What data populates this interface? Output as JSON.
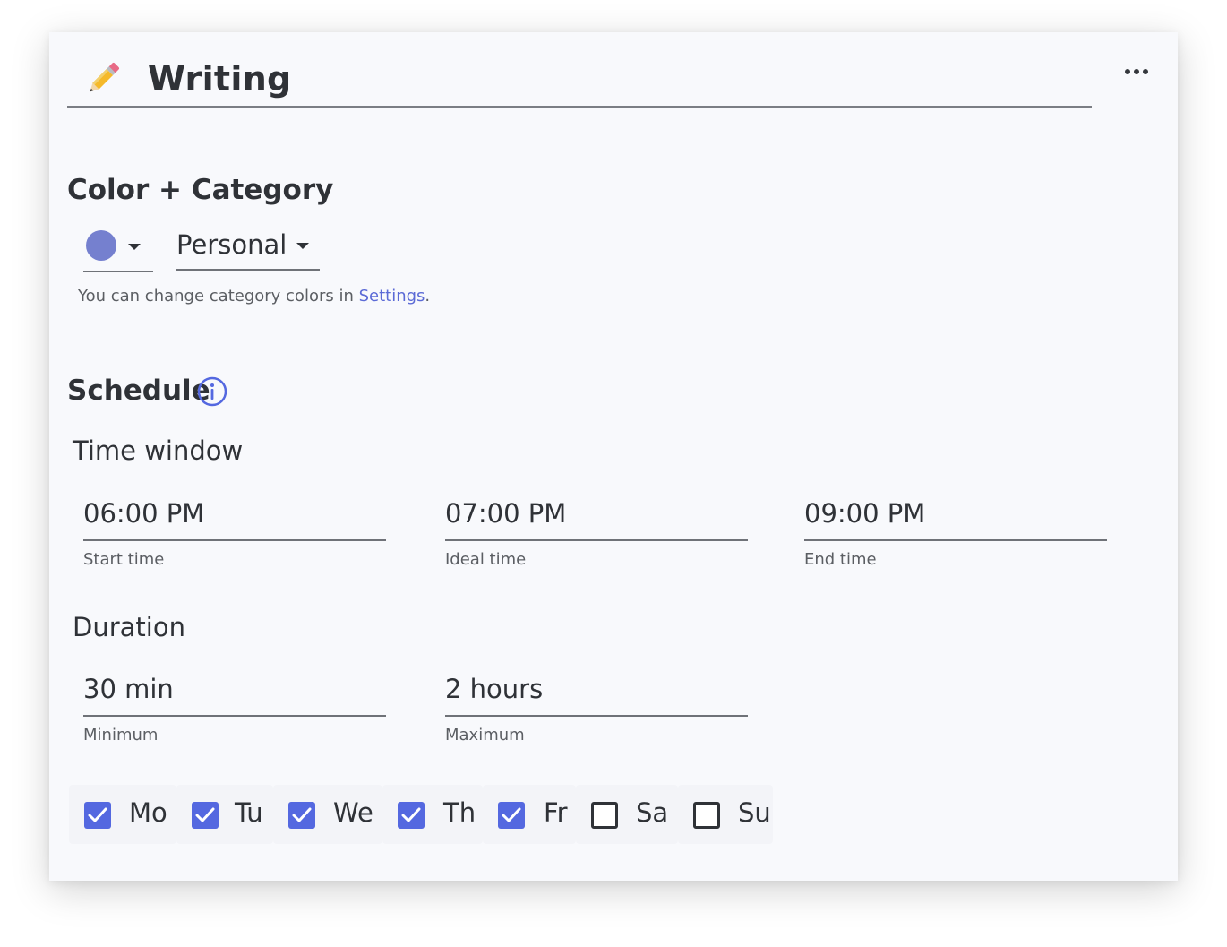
{
  "header": {
    "title": "Writing",
    "icon": "pencil-icon",
    "menu_icon": "more-horizontal-icon"
  },
  "color_category": {
    "section_title": "Color + Category",
    "color_value": "#7580cf",
    "category": "Personal",
    "helper_prefix": "You can change category colors in ",
    "helper_link": "Settings",
    "helper_suffix": "."
  },
  "schedule": {
    "section_title": "Schedule",
    "info_icon": "info-icon",
    "time_window": {
      "title": "Time window",
      "start": {
        "value": "06:00 PM",
        "label": "Start time"
      },
      "ideal": {
        "value": "07:00 PM",
        "label": "Ideal time"
      },
      "end": {
        "value": "09:00 PM",
        "label": "End time"
      }
    },
    "duration": {
      "title": "Duration",
      "min": {
        "value": "30 min",
        "label": "Minimum"
      },
      "max": {
        "value": "2 hours",
        "label": "Maximum"
      }
    },
    "days": [
      {
        "label": "Mo",
        "checked": true
      },
      {
        "label": "Tu",
        "checked": true
      },
      {
        "label": "We",
        "checked": true
      },
      {
        "label": "Th",
        "checked": true
      },
      {
        "label": "Fr",
        "checked": true
      },
      {
        "label": "Sa",
        "checked": false
      },
      {
        "label": "Su",
        "checked": false
      }
    ]
  },
  "colors": {
    "accent": "#5468e0",
    "link": "#5b6ad6",
    "text": "#2f3237"
  }
}
